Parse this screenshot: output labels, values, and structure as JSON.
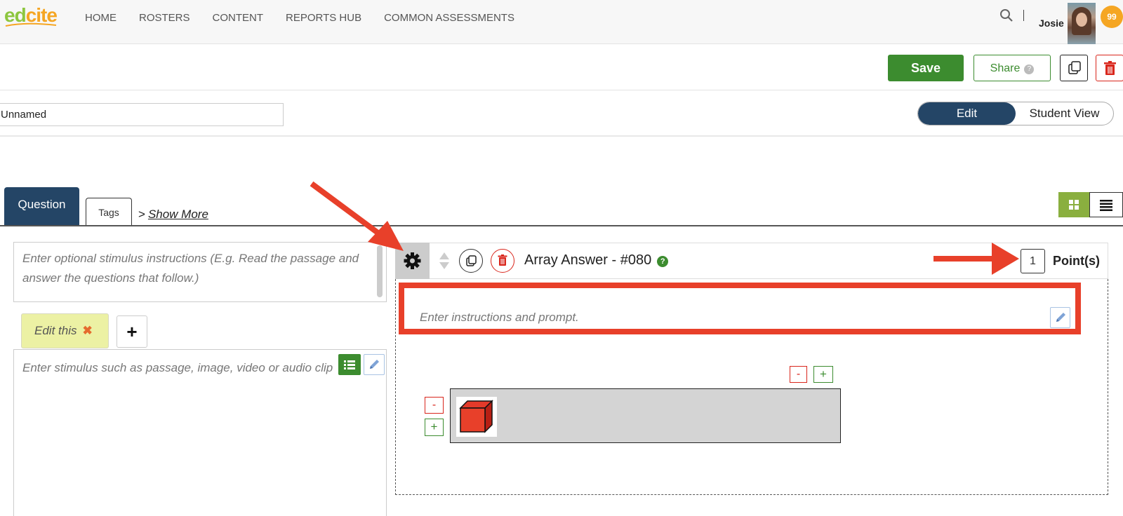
{
  "app": {
    "logo_part1": "ed",
    "logo_part2": "cite"
  },
  "nav": {
    "links": [
      "HOME",
      "ROSTERS",
      "CONTENT",
      "REPORTS HUB",
      "COMMON ASSESSMENTS"
    ],
    "user_name": "Josie",
    "notification_count": "99"
  },
  "toolbar": {
    "save_label": "Save",
    "share_label": "Share",
    "share_help": "?"
  },
  "title_bar": {
    "name_value": "Unnamed",
    "edit_label": "Edit",
    "student_view_label": "Student View"
  },
  "tabs": {
    "question_label": "Question",
    "tags_label": "Tags",
    "show_more_label": "Show More"
  },
  "stimulus": {
    "instructions_placeholder": "Enter optional stimulus instructions (E.g. Read the passage and answer the questions that follow.)",
    "edit_tab_label": "Edit this",
    "add_tab_label": "+",
    "content_placeholder": "Enter stimulus such as passage, image, video or audio clip"
  },
  "question": {
    "title": "Array Answer - #080",
    "help": "?",
    "points_value": "1",
    "points_label": "Point(s)",
    "prompt_placeholder": "Enter instructions and prompt.",
    "minus_label": "-",
    "plus_label": "+"
  },
  "colors": {
    "brand_green": "#3c8c2f",
    "navy": "#244566",
    "danger_red": "#d9261c",
    "annotation_red": "#e8402a",
    "badge_orange": "#f5a623"
  }
}
